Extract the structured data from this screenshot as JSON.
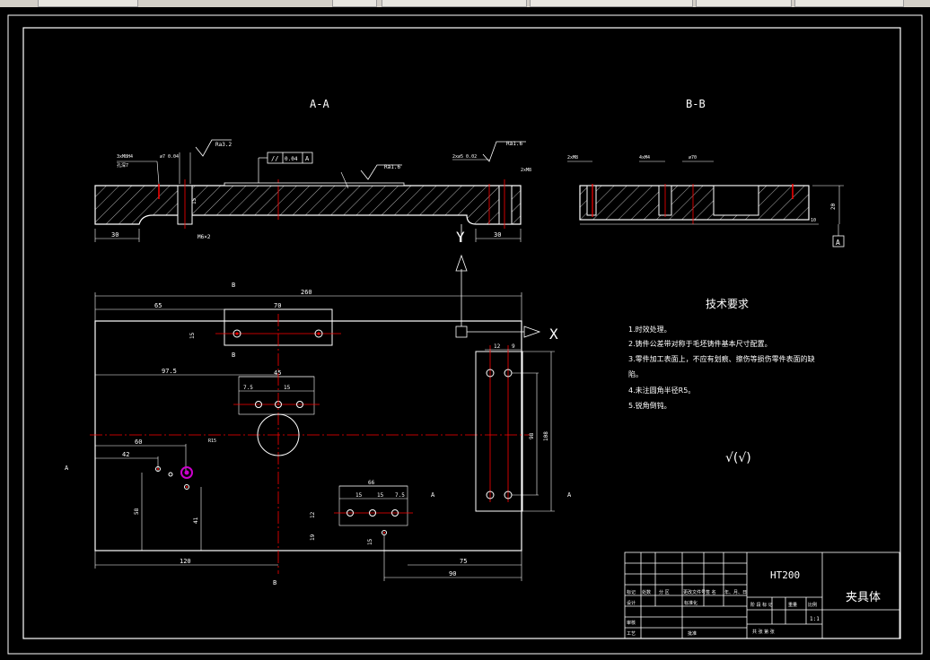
{
  "views": {
    "section_a": "A-A",
    "section_b": "B-B"
  },
  "axes": {
    "y": "Y",
    "x": "X"
  },
  "tech_req": {
    "title": "技术要求",
    "items": [
      "1.时效处理。",
      "2.铸件公差带对称于毛坯铸件基本尺寸配置。",
      "3.零件加工表面上，不应有划痕、擦伤等损伤零件表面的缺",
      "陷。",
      "4.未注圆角半径R5。",
      "5.锐角倒钝。"
    ]
  },
  "roughness_symbol": "√(√)",
  "title_block": {
    "material": "HT200",
    "part_name": "夹具体",
    "scale": "1:1",
    "row_labels": [
      "标记",
      "处数",
      "分 区",
      "更改文件号",
      "签 名",
      "年、月、日"
    ],
    "label_design": "设计",
    "label_standard": "标准化",
    "label_stage": "阶 段 标 记",
    "label_weight": "重量",
    "label_ratio": "比例",
    "label_review": "审核",
    "label_process": "工艺",
    "label_approve": "批准",
    "label_sheets": "共   张 第   张"
  },
  "dims": {
    "a_30_left": "30",
    "a_30_right": "30",
    "a_m": "M6×2",
    "a_15": "15",
    "a_flat": "0.04",
    "a_ra_1": "Ra3.2",
    "a_ra_2": "Ra1.6",
    "a_ra_3": "Ra1.6",
    "a_datum": "A",
    "b_16": "16",
    "b_10": "10",
    "b_20": "20",
    "b_datum": "A",
    "p_260": "260",
    "p_65": "65",
    "p_70": "70",
    "p_15": "15",
    "p_97": "97.5",
    "p_45": "45",
    "p_7_5a": "7.5",
    "p_15a": "15",
    "p_60": "60",
    "p_42": "42",
    "p_58": "58",
    "p_41": "41",
    "p_120": "120",
    "p_66": "66",
    "p_15b": "15",
    "p_15c": "15",
    "p_7_5b": "7.5",
    "p_12": "12",
    "p_19": "19",
    "p_15d": "15",
    "p_75": "75",
    "p_90": "90",
    "p_12_9a": "12",
    "p_12_9b": "9",
    "p_98": "98",
    "p_108": "108",
    "p_r": "R15",
    "sec_b": "B",
    "sec_a": "A"
  },
  "colors": {
    "background": "#000000",
    "line": "#ffffff",
    "center": "#ff0000",
    "hatch": "#ffffff",
    "accent": "#cc00cc"
  }
}
